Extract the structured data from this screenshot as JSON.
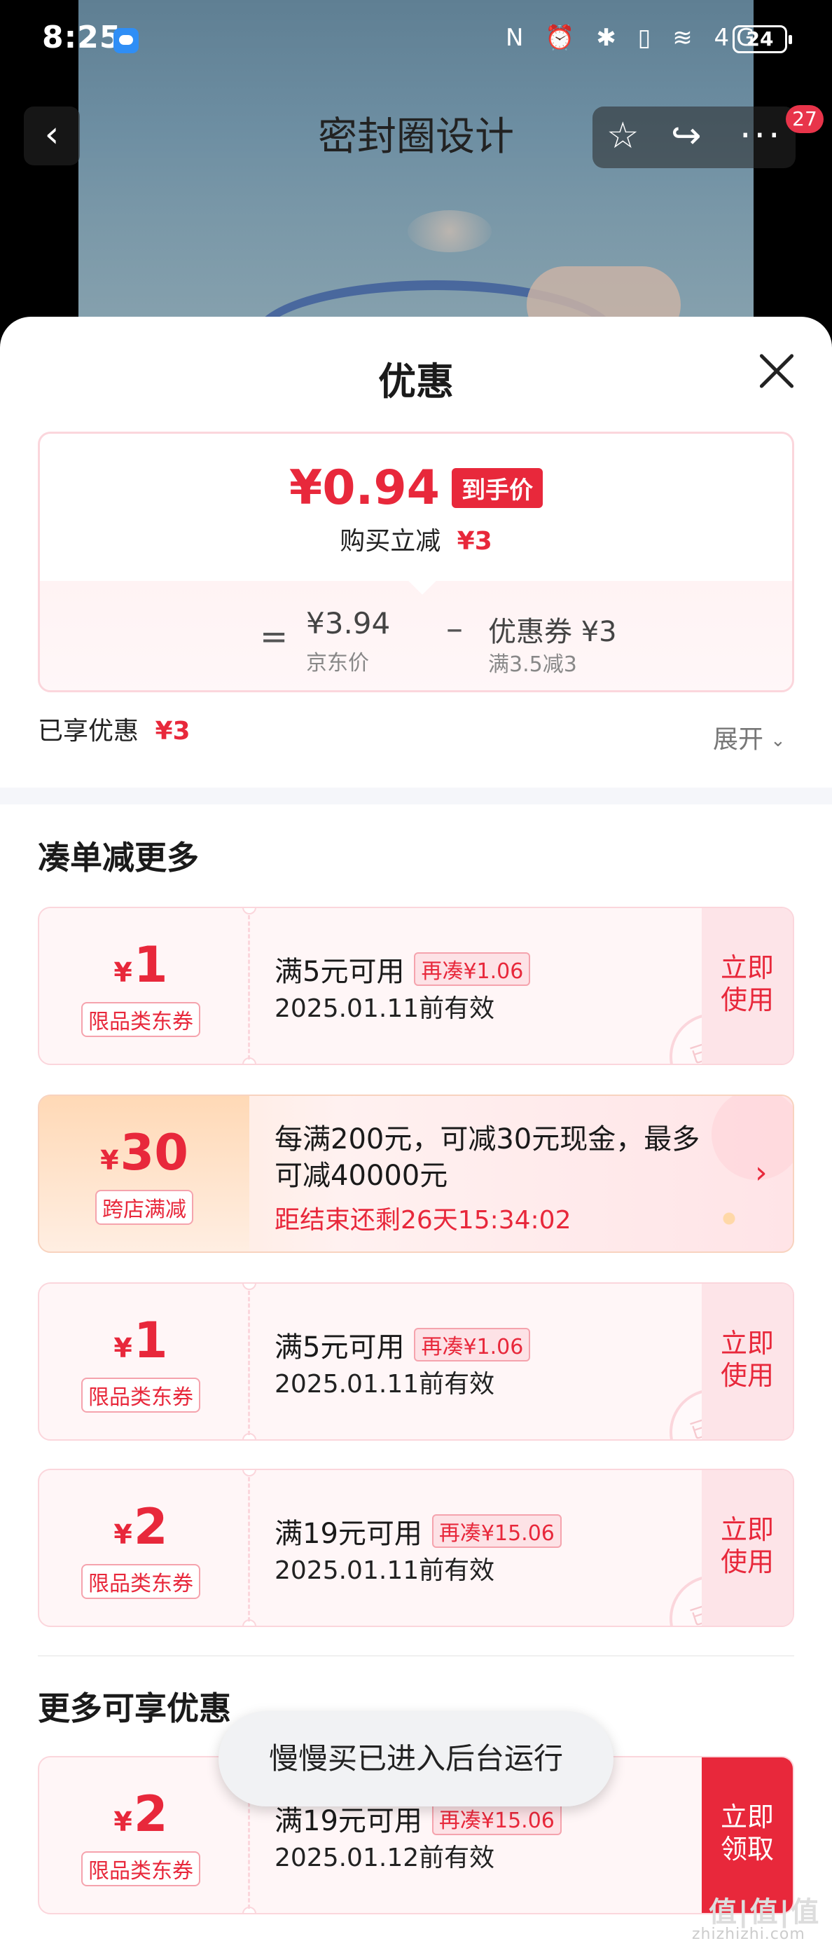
{
  "status_bar": {
    "time": "8:25",
    "icons": "N ⏰ ✱ ▯ ≋ 4G",
    "battery": "24"
  },
  "product_header": {
    "title": "密封圈设计",
    "back_icon": "‹",
    "star_icon": "☆",
    "share_icon": "↪",
    "more_icon": "···",
    "badge_count": "27"
  },
  "sheet": {
    "title": "优惠",
    "price_summary": {
      "final_price": "¥0.94",
      "final_price_tag": "到手价",
      "instant_label": "购买立减",
      "instant_amount": "¥3",
      "eq": "=",
      "jd_price": "¥3.94",
      "jd_price_label": "京东价",
      "minus": "–",
      "coupon_amount": "优惠券 ¥3",
      "coupon_condition": "满3.5减3"
    },
    "enjoyed_label": "已享优惠",
    "enjoyed_amount": "¥3",
    "expand_label": "展开",
    "section1_title": "凑单减更多",
    "section2_title": "更多可享优惠",
    "coupons": [
      {
        "yen": "¥",
        "amount": "1",
        "type": "限品类东券",
        "condition": "满5元可用",
        "need": "再凑¥1.06",
        "valid": "2025.01.11前有效",
        "button": "立即\n使用",
        "stamp": "已领"
      },
      {
        "yen": "¥",
        "amount": "1",
        "type": "限品类东券",
        "condition": "满5元可用",
        "need": "再凑¥1.06",
        "valid": "2025.01.11前有效",
        "button": "立即\n使用",
        "stamp": "已领"
      },
      {
        "yen": "¥",
        "amount": "2",
        "type": "限品类东券",
        "condition": "满19元可用",
        "need": "再凑¥15.06",
        "valid": "2025.01.11前有效",
        "button": "立即\n使用",
        "stamp": "已领"
      },
      {
        "yen": "¥",
        "amount": "2",
        "type": "限品类东券",
        "condition": "满19元可用",
        "need": "再凑¥15.06",
        "valid": "2025.01.12前有效",
        "button": "立即\n领取",
        "stamp": ""
      }
    ],
    "promo": {
      "yen": "¥",
      "amount": "30",
      "type": "跨店满减",
      "description": "每满200元，可减30元现金，最多可减40000元",
      "countdown": "距结束还剩26天15:34:02",
      "arrow": "›"
    }
  },
  "toast": "慢慢买已进入后台运行",
  "watermark": {
    "logo": "值|值|值",
    "site": "zhizhizhi.com"
  },
  "colors": {
    "accent": "#e8283b",
    "coupon_bg": "#fff6f7",
    "border": "#fbd6dc"
  }
}
